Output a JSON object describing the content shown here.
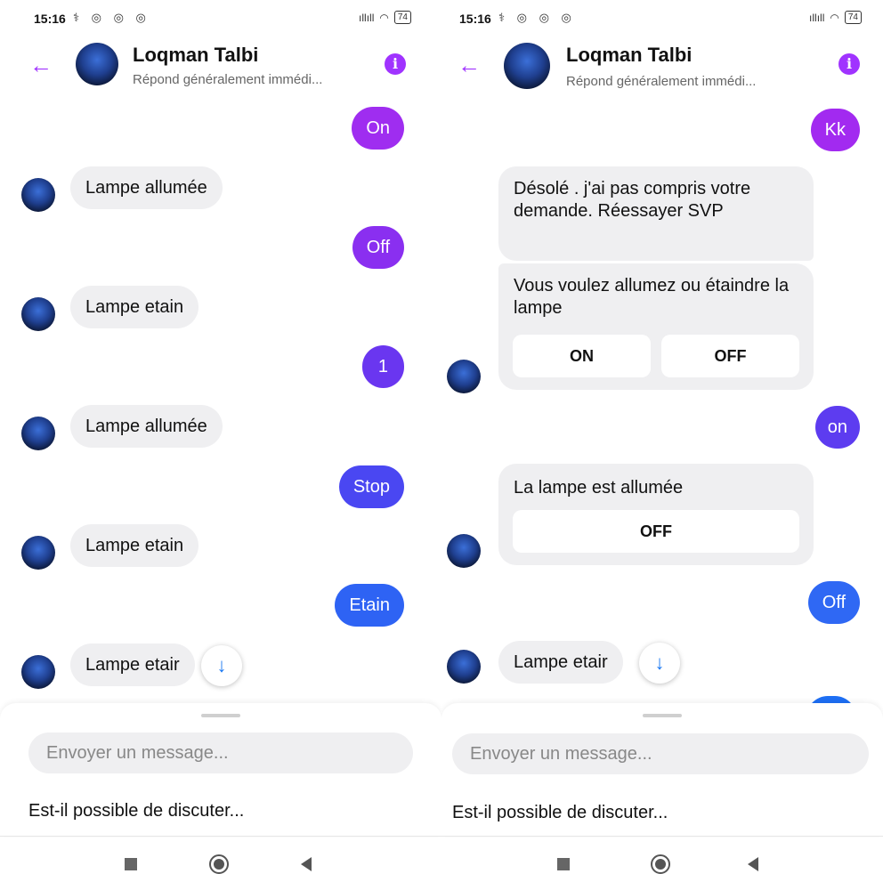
{
  "status": {
    "time": "15:16",
    "icons": "⚕ ◎ ◎ ◎",
    "signal": "ıllıll",
    "battery": "74"
  },
  "colors": {
    "accent": "#a033ff",
    "bubble_incoming": "#efeff1"
  },
  "icons": [
    "back-arrow-icon",
    "info-icon",
    "scroll-down-icon",
    "recents-icon",
    "home-icon",
    "back-icon"
  ],
  "left": {
    "header": {
      "name": "Loqman Talbi",
      "subtitle": "Répond généralement immédi..."
    },
    "messages": [
      {
        "dir": "out",
        "text": "On"
      },
      {
        "dir": "in",
        "text": "Lampe allumée"
      },
      {
        "dir": "out",
        "text": "Off"
      },
      {
        "dir": "in",
        "text": "Lampe etain"
      },
      {
        "dir": "out",
        "text": "1"
      },
      {
        "dir": "in",
        "text": "Lampe allumée"
      },
      {
        "dir": "out",
        "text": "Stop"
      },
      {
        "dir": "in",
        "text": "Lampe etain"
      },
      {
        "dir": "out",
        "text": "Etain"
      },
      {
        "dir": "in",
        "text": "Lampe etair"
      }
    ],
    "composer": {
      "placeholder": "Envoyer un message...",
      "suggestion": "Est-il possible de discuter..."
    }
  },
  "right": {
    "header": {
      "name": "Loqman Talbi",
      "subtitle": "Répond généralement immédi..."
    },
    "messages": [
      {
        "dir": "out",
        "text": "Kk"
      },
      {
        "dir": "in",
        "text": "Désolé . j'ai pas compris votre demande. Réessayer SVP"
      },
      {
        "dir": "in",
        "text": "Vous voulez allumez ou étaindre la lampe",
        "buttons": [
          "ON",
          "OFF"
        ]
      },
      {
        "dir": "out",
        "text": "on"
      },
      {
        "dir": "in",
        "text": "La lampe est allumée",
        "buttons": [
          "OFF"
        ]
      },
      {
        "dir": "out",
        "text": "Off"
      },
      {
        "dir": "in",
        "text": "Lampe etair"
      }
    ],
    "composer": {
      "placeholder": "Envoyer un message...",
      "suggestion": "Est-il possible de discuter..."
    }
  }
}
